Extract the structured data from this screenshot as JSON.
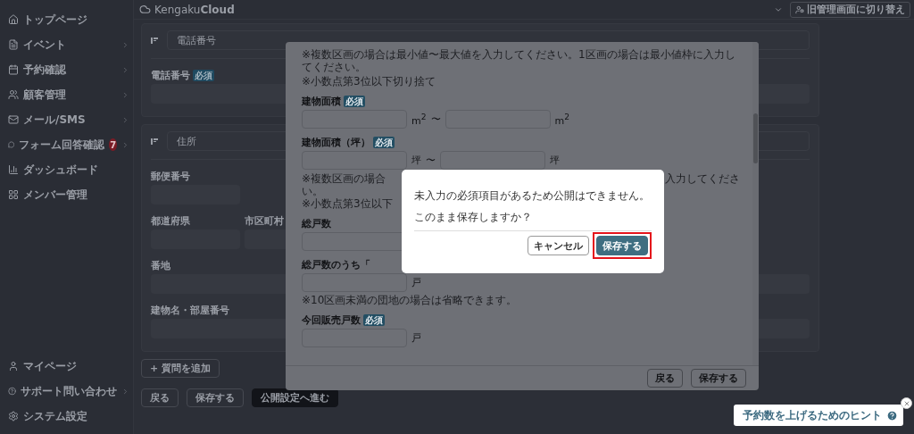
{
  "sidebar": {
    "items": [
      {
        "label": "トップページ",
        "has_submenu": false
      },
      {
        "label": "イベント",
        "has_submenu": true
      },
      {
        "label": "予約確認",
        "has_submenu": true
      },
      {
        "label": "顧客管理",
        "has_submenu": true
      },
      {
        "label": "メール/SMS",
        "has_submenu": true
      },
      {
        "label": "フォーム回答確認",
        "has_submenu": true,
        "badge": "7"
      },
      {
        "label": "ダッシュボード",
        "has_submenu": false
      },
      {
        "label": "メンバー管理",
        "has_submenu": false
      }
    ],
    "bottom_items": [
      {
        "label": "マイページ",
        "has_submenu": false
      },
      {
        "label": "サポート問い合わせ",
        "has_submenu": true
      },
      {
        "label": "システム設定",
        "has_submenu": false
      }
    ]
  },
  "header": {
    "logo": "Kengaku**Cloud**",
    "switch_button": "旧管理画面に切り替え"
  },
  "form_cards": [
    {
      "question": "電話番号",
      "fields": [
        {
          "label": "電話番号",
          "badge": "必須",
          "kind": "full"
        }
      ]
    },
    {
      "question": "住所",
      "fields": [
        {
          "label": "郵便番号",
          "kind": "short"
        },
        {
          "label": "都道府県",
          "kind": "pair"
        },
        {
          "label": "市区町村",
          "kind": "pair"
        },
        {
          "label": "番地",
          "kind": "full"
        },
        {
          "label": "建物名・部屋番号",
          "kind": "full"
        }
      ]
    }
  ],
  "add_question_button": "+ 質問を追加",
  "actions": [
    {
      "label": "戻る",
      "primary": false
    },
    {
      "label": "保存する",
      "primary": false
    },
    {
      "label": "公開設定へ進む",
      "primary": true
    }
  ],
  "modal": {
    "blocks": [
      {
        "kind": "note",
        "lines": [
          "※複数区画の場合は最小値〜最大値を入力してください。1区画の場合は最小値枠に入力してください。",
          "※小数点第3位以下切り捨て"
        ]
      },
      {
        "kind": "range",
        "label": "建物面積",
        "badge": "必須",
        "unit_from": "m$^{2}$",
        "separator": "〜",
        "unit_to": "m$^{2}$"
      },
      {
        "kind": "range",
        "label": "建物面積（坪）",
        "badge": "必須",
        "unit_from": "坪",
        "separator": "〜",
        "unit_to": "坪"
      },
      {
        "kind": "partial_note",
        "rows": [
          {
            "left": "※複数区画の場合",
            "right": "入力してくださ"
          },
          {
            "left": "い。"
          },
          {
            "left": "※小数点第3位以下"
          }
        ]
      },
      {
        "kind": "single",
        "label": "総戸数"
      },
      {
        "kind": "single",
        "label": "総戸数のうち「",
        "unit": "戸"
      },
      {
        "kind": "note",
        "lines": [
          "※10区画未満の団地の場合は省略できます。"
        ]
      },
      {
        "kind": "single",
        "label": "今回販売戸数",
        "badge": "必須",
        "unit": "戸"
      }
    ],
    "buttons": [
      "戻る",
      "保存する"
    ]
  },
  "dialog": {
    "message": "未入力の必須項目があるため公開はできません。",
    "question": "このまま保存しますか？",
    "buttons": [
      {
        "label": "キャンセル",
        "primary": false,
        "highlighted": false
      },
      {
        "label": "保存する",
        "primary": true,
        "highlighted": true
      }
    ]
  },
  "hint": {
    "label": "予約数を上げるためのヒント"
  }
}
